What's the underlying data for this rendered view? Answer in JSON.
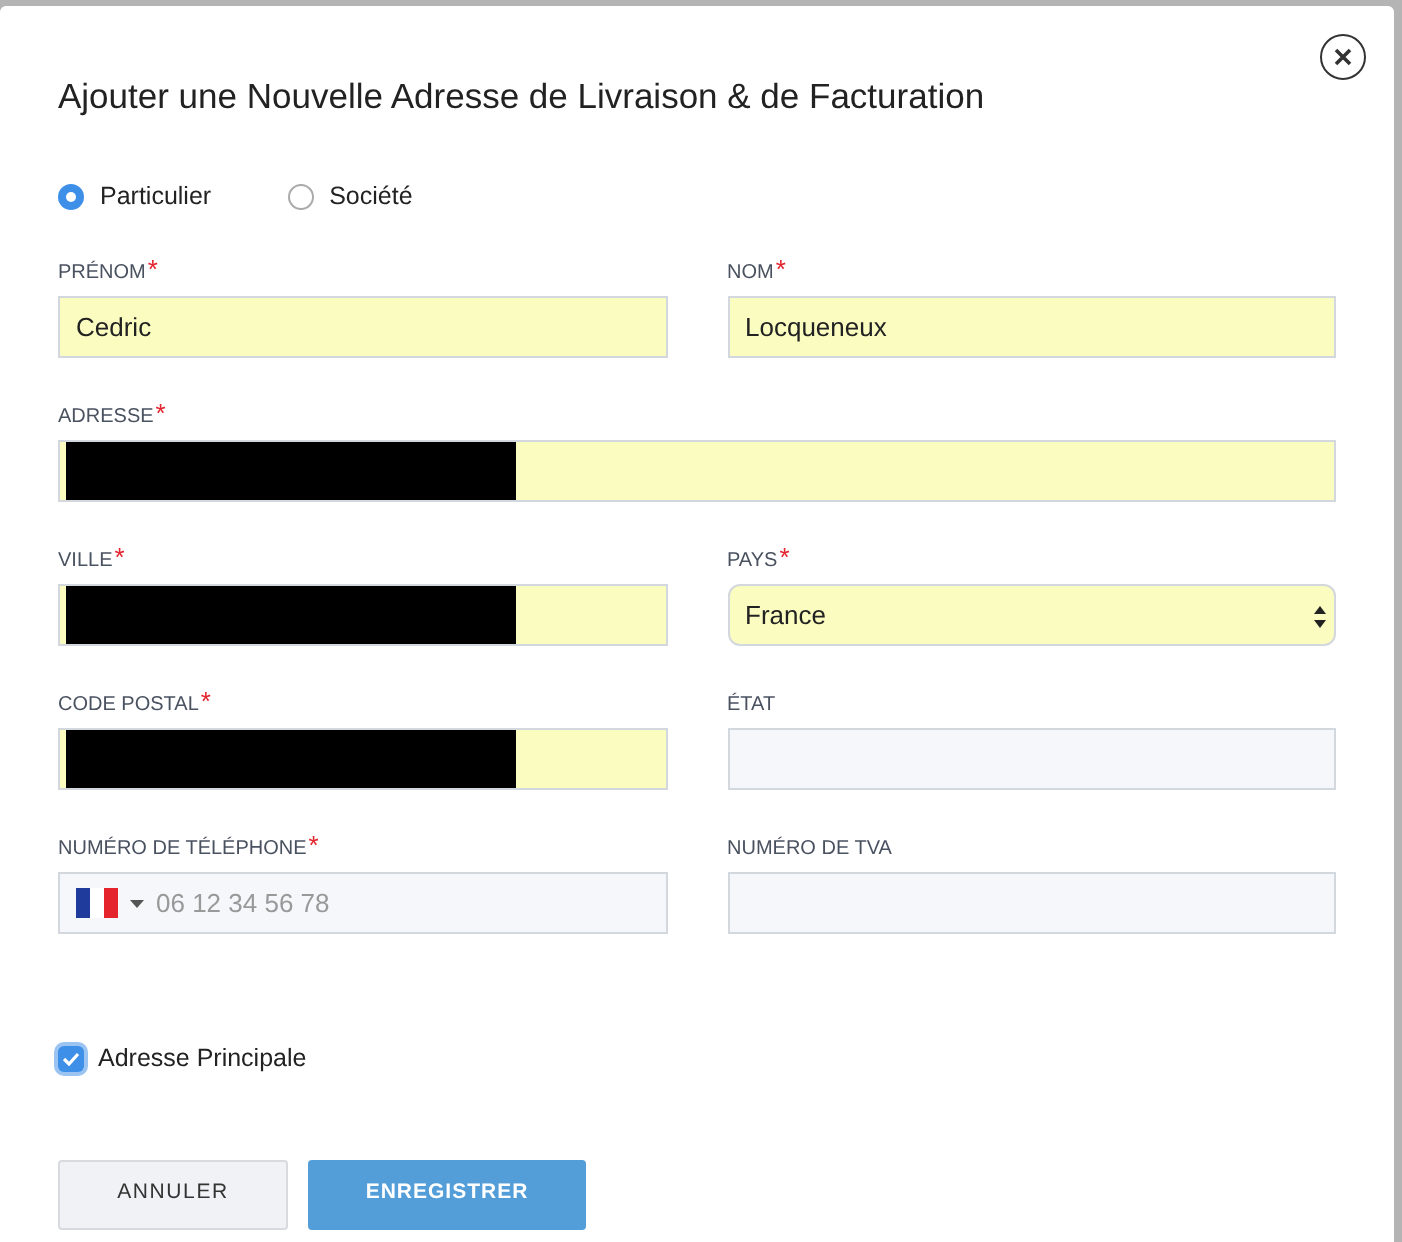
{
  "dialog": {
    "title": "Ajouter une Nouvelle Adresse de Livraison & de Facturation"
  },
  "account_type": [
    {
      "label": "Particulier",
      "selected": true
    },
    {
      "label": "Société",
      "selected": false
    }
  ],
  "rows": [
    [
      {
        "label": "PRÉNOM",
        "required_mark": "*",
        "kind": "text",
        "value": "Cedric",
        "autofilled": true
      },
      {
        "label": "NOM",
        "required_mark": "*",
        "kind": "text",
        "value": "Locqueneux",
        "autofilled": true
      }
    ],
    [
      {
        "label": "ADRESSE",
        "required_mark": "*",
        "kind": "text",
        "autofilled": true,
        "redacted": true
      }
    ],
    [
      {
        "label": "VILLE",
        "required_mark": "*",
        "kind": "text",
        "autofilled": true,
        "redacted": true
      },
      {
        "label": "PAYS",
        "required_mark": "*",
        "kind": "select",
        "value": "France",
        "autofilled": true
      }
    ],
    [
      {
        "label": "CODE POSTAL",
        "required_mark": "*",
        "kind": "text",
        "autofilled": true,
        "redacted": true
      },
      {
        "label": "ÉTAT",
        "kind": "text",
        "autofilled": false
      }
    ],
    [
      {
        "label": "NUMÉRO DE TÉLÉPHONE",
        "required_mark": "*",
        "kind": "phone",
        "placeholder": "06 12 34 56 78",
        "autofilled": false
      },
      {
        "label": "NUMÉRO DE TVA",
        "kind": "text",
        "autofilled": false
      }
    ]
  ],
  "primary_address": {
    "label": "Adresse Principale",
    "checked": true
  },
  "buttons": [
    {
      "label": "ANNULER",
      "kind": "secondary"
    },
    {
      "label": "ENREGISTRER",
      "kind": "primary"
    }
  ]
}
